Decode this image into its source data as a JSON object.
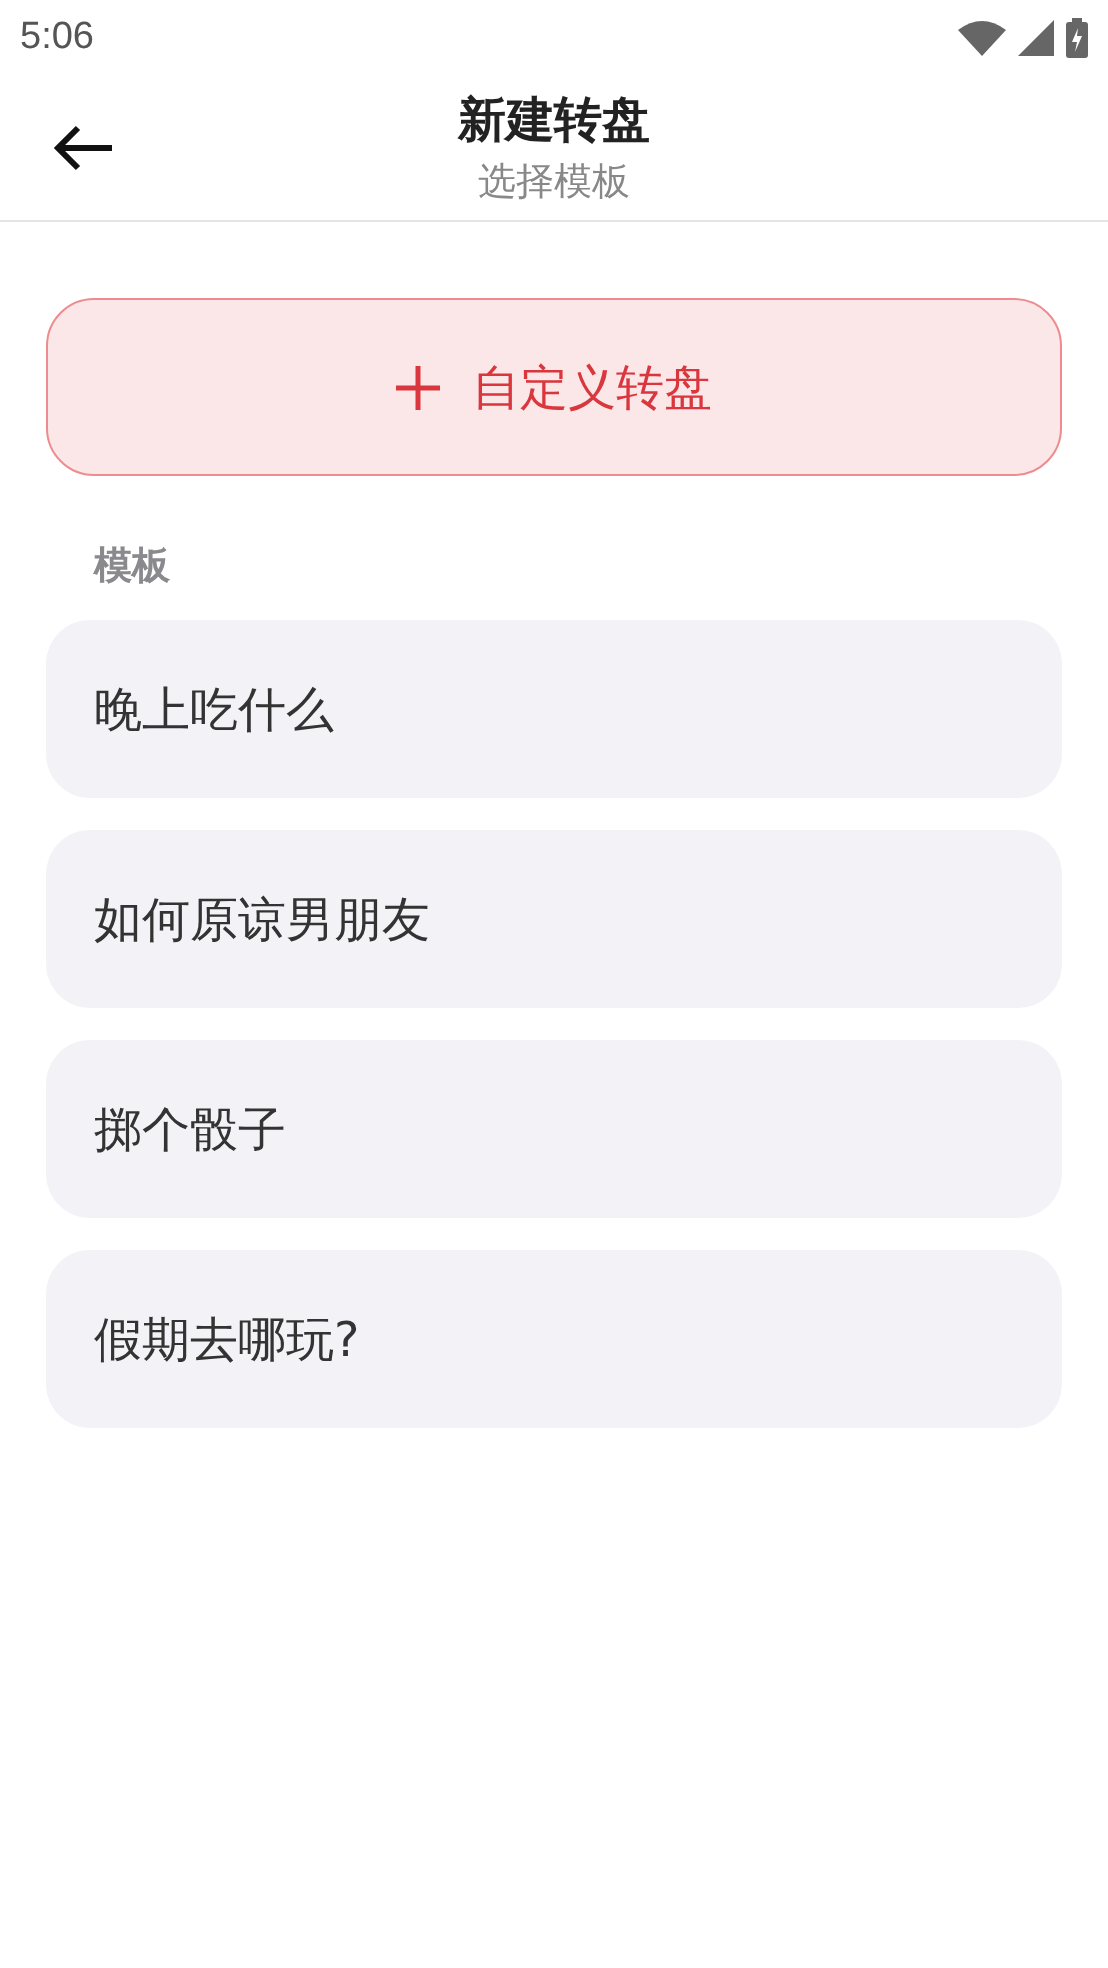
{
  "status_bar": {
    "time": "5:06"
  },
  "header": {
    "title": "新建转盘",
    "subtitle": "选择模板"
  },
  "custom_button": {
    "label": "自定义转盘"
  },
  "section_label": "模板",
  "templates": [
    {
      "label": "晚上吃什么"
    },
    {
      "label": "如何原谅男朋友"
    },
    {
      "label": "掷个骰子"
    },
    {
      "label": "假期去哪玩?"
    }
  ]
}
